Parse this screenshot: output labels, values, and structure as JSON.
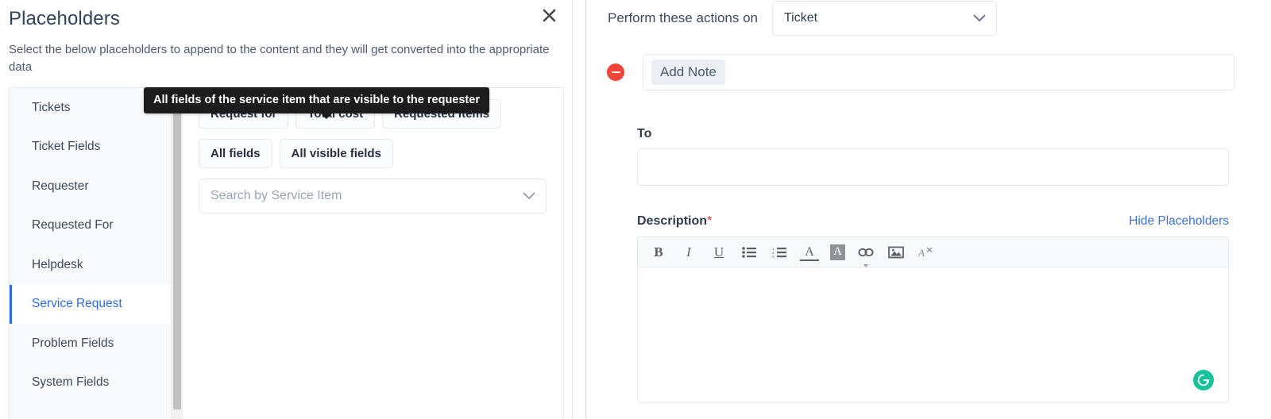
{
  "dialog": {
    "title": "Placeholders",
    "subtitle": "Select the below placeholders to append to the content and they will get converted into the appropriate data",
    "close_label": "×",
    "sidebar": {
      "items": [
        {
          "label": "Tickets",
          "active": false
        },
        {
          "label": "Ticket Fields",
          "active": false
        },
        {
          "label": "Requester",
          "active": false
        },
        {
          "label": "Requested For",
          "active": false
        },
        {
          "label": "Helpdesk",
          "active": false
        },
        {
          "label": "Service Request",
          "active": true
        },
        {
          "label": "Problem Fields",
          "active": false
        },
        {
          "label": "System Fields",
          "active": false
        }
      ]
    },
    "content": {
      "field_chips": [
        "Request for",
        "Total cost",
        "Requested Items"
      ],
      "group_chips": [
        "All fields",
        "All visible fields"
      ],
      "search": {
        "placeholder": "Search by Service Item",
        "value": ""
      }
    },
    "tooltip": {
      "text": "All fields of the service item that are visible to the requester"
    }
  },
  "actions": {
    "header_label": "Perform these actions on",
    "module_select": {
      "value": "Ticket",
      "options": [
        "Ticket"
      ]
    },
    "rows": [
      {
        "remove_icon": "minus-circle-icon",
        "action_label": "Add Note"
      }
    ],
    "to_field": {
      "label": "To",
      "value": "",
      "placeholder": ""
    },
    "description": {
      "label": "Description",
      "required_marker": "*",
      "hide_placeholders_label": "Hide Placeholders",
      "value": "",
      "toolbar": [
        {
          "name": "bold-icon",
          "glyph": "B"
        },
        {
          "name": "italic-icon",
          "glyph": "I"
        },
        {
          "name": "underline-icon",
          "glyph": "U"
        },
        {
          "name": "bullet-list-icon",
          "glyph": ""
        },
        {
          "name": "numbered-list-icon",
          "glyph": ""
        },
        {
          "name": "font-color-icon",
          "glyph": "A"
        },
        {
          "name": "highlight-color-icon",
          "glyph": "A"
        },
        {
          "name": "insert-link-icon",
          "glyph": ""
        },
        {
          "name": "insert-image-icon",
          "glyph": ""
        },
        {
          "name": "clear-formatting-icon",
          "glyph": ""
        }
      ],
      "assistant_badge": "grammarly-icon"
    }
  },
  "colors": {
    "accent_blue": "#2d6ae3",
    "link_blue": "#3c71d9",
    "danger_red": "#f04438",
    "required_red": "#e02d2d",
    "grammarly_green": "#15c39a",
    "tooltip_bg": "#1c1c1c",
    "sidebar_bg": "#f8f9fb",
    "toolbar_bg": "#f7f9fb"
  }
}
